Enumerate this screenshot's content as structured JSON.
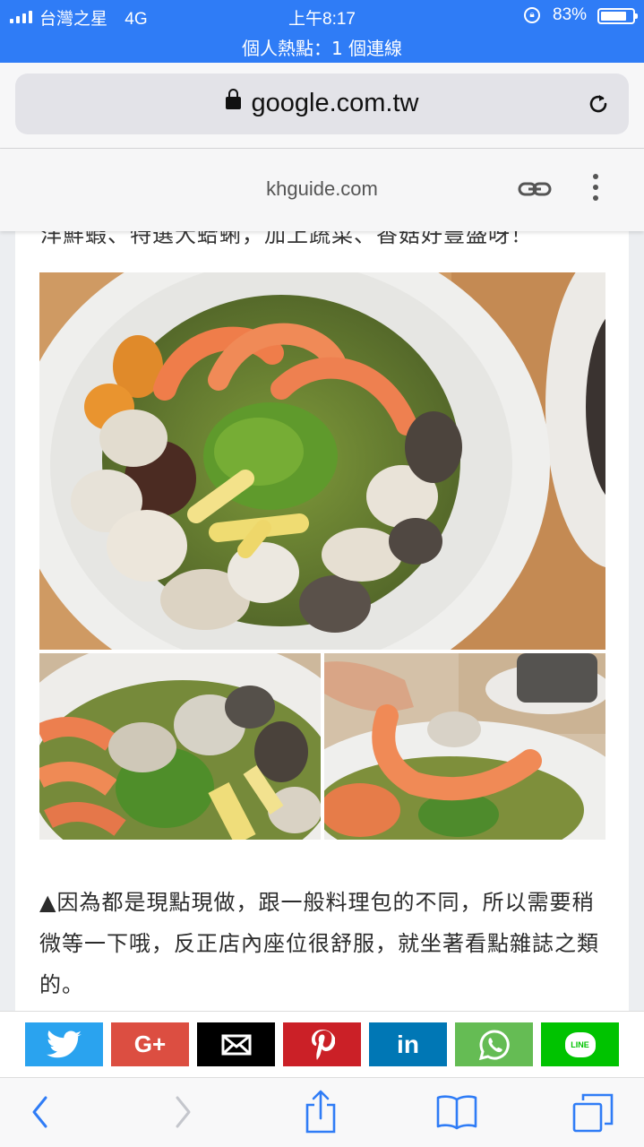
{
  "status_bar": {
    "carrier": "台灣之星",
    "network": "4G",
    "time": "上午8:17",
    "battery": "83%",
    "battery_level": 0.83,
    "hotspot": "個人熱點：1 個連線"
  },
  "address_bar": {
    "url": "google.com.tw"
  },
  "site_header": {
    "domain": "khguide.com"
  },
  "article": {
    "clipped_line": "洋鮮蝦、特選大蛤蜊，加上蔬菜、香菇好豐盛呀！",
    "caption": "▲因為都是現點現做，跟一般料理包的不同，所以需要稍微等一下哦，反正店內座位很舒服，就坐著看點雜誌之類的。"
  },
  "share_buttons": [
    {
      "name": "twitter",
      "color": "#2aa3ef"
    },
    {
      "name": "google-plus",
      "color": "#dc4e41",
      "label": "G+"
    },
    {
      "name": "email",
      "color": "#000000"
    },
    {
      "name": "pinterest",
      "color": "#cb2027"
    },
    {
      "name": "linkedin",
      "color": "#0077b5",
      "label": "in"
    },
    {
      "name": "whatsapp",
      "color": "#65bc54"
    },
    {
      "name": "line",
      "color": "#00c300",
      "label": "LINE"
    }
  ],
  "colors": {
    "status_bar": "#2f7cf6",
    "safari_blue": "#2f7cf6"
  }
}
